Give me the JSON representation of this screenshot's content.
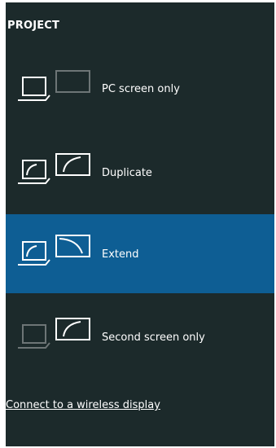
{
  "header": {
    "title": "PROJECT"
  },
  "options": [
    {
      "label": "PC screen only",
      "icon": "pc-screen-only-icon"
    },
    {
      "label": "Duplicate",
      "icon": "duplicate-icon"
    },
    {
      "label": "Extend",
      "icon": "extend-icon",
      "selected": true
    },
    {
      "label": "Second screen only",
      "icon": "second-screen-only-icon"
    }
  ],
  "footer": {
    "link_label": "Connect to a wireless display"
  },
  "colors": {
    "panel_background": "#1c2a2b",
    "selected_background": "#0e5e94",
    "text": "#ffffff",
    "dim_outline": "#6d7576"
  }
}
